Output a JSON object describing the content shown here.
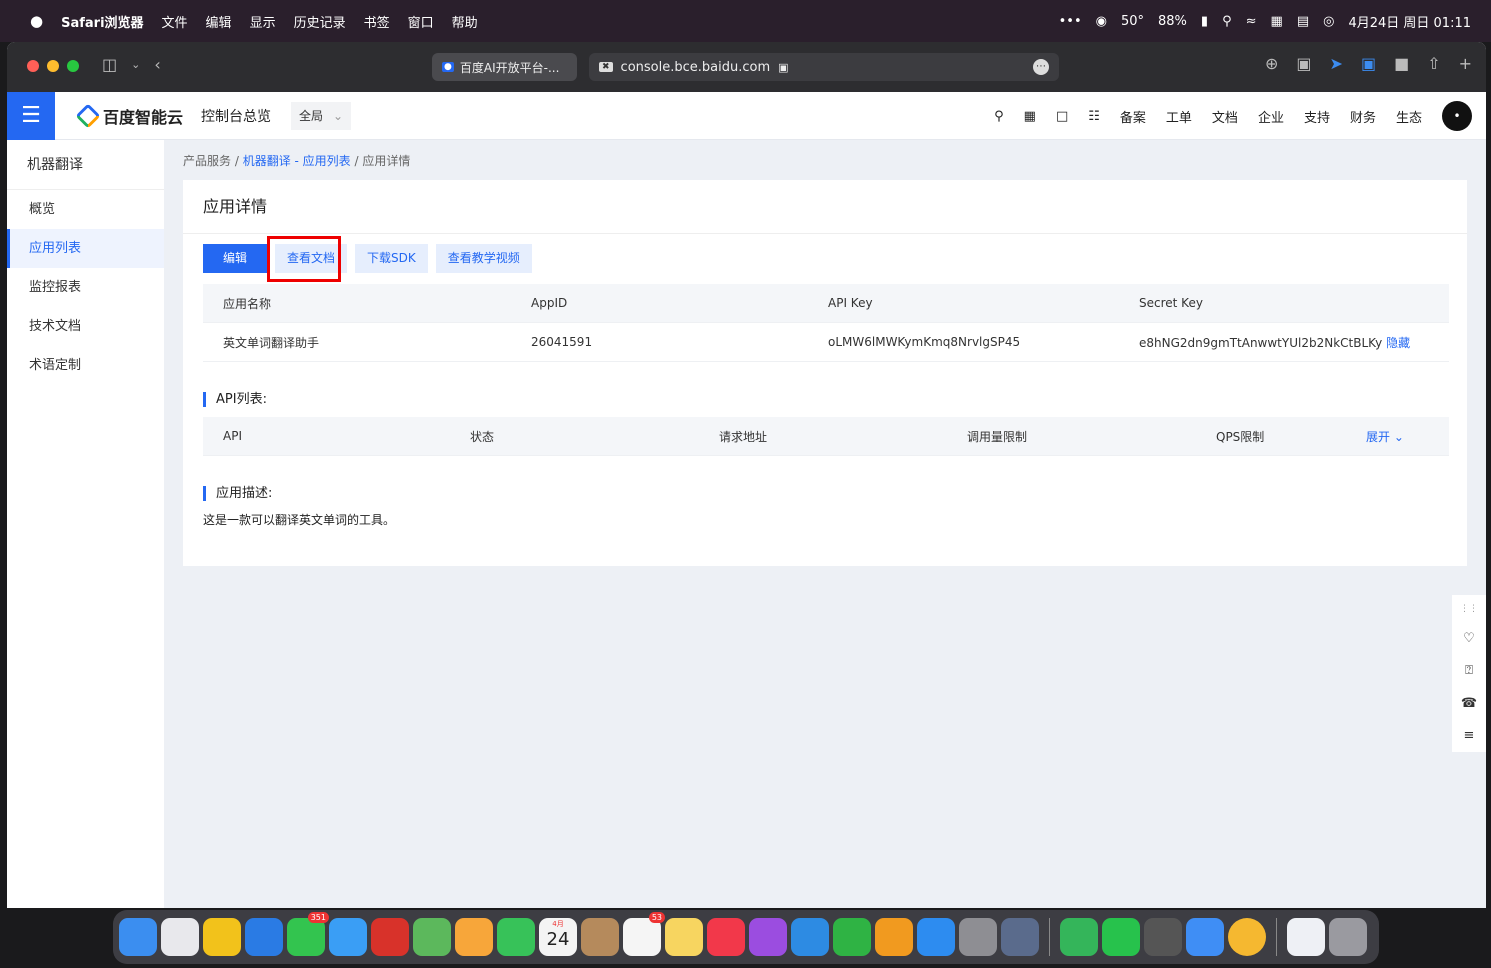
{
  "menubar": {
    "apple": "",
    "app": "Safari浏览器",
    "items": [
      "文件",
      "编辑",
      "显示",
      "历史记录",
      "书签",
      "窗口",
      "帮助"
    ],
    "status": {
      "dots": "•••",
      "temp": "50°",
      "battery": "88%",
      "datetime": "4月24日 周日 01:11"
    }
  },
  "browser": {
    "tab1_title": "百度AI开放平台-...",
    "url": "console.bce.baidu.com"
  },
  "topnav": {
    "logo": "百度智能云",
    "console": "控制台总览",
    "region": "全局",
    "links": [
      "备案",
      "工单",
      "文档",
      "企业",
      "支持",
      "财务",
      "生态"
    ]
  },
  "sidebar": {
    "title": "机器翻译",
    "items": [
      "概览",
      "应用列表",
      "监控报表",
      "技术文档",
      "术语定制"
    ]
  },
  "breadcrumb": {
    "root": "产品服务",
    "mid": "机器翻译 - 应用列表",
    "current": "应用详情",
    "sep": "/"
  },
  "card": {
    "title": "应用详情",
    "buttons": {
      "edit": "编辑",
      "docs": "查看文档",
      "sdk": "下载SDK",
      "video": "查看教学视频"
    },
    "table": {
      "headers": [
        "应用名称",
        "AppID",
        "API Key",
        "Secret Key"
      ],
      "row": {
        "name": "英文单词翻译助手",
        "appid": "26041591",
        "apikey": "oLMW6lMWKymKmq8NrvlgSP45",
        "secret": "e8hNG2dn9gmTtAnwwtYUl2b2NkCtBLKy",
        "hide": "隐藏"
      }
    },
    "api_section": "API列表:",
    "api_headers": [
      "API",
      "状态",
      "请求地址",
      "调用量限制",
      "QPS限制",
      "展开"
    ],
    "desc_section": "应用描述:",
    "desc": "这是一款可以翻译英文单词的工具。"
  },
  "dock": {
    "messages_badge": "351",
    "reminders_badge": "53",
    "calendar_month": "4月",
    "calendar_day": "24"
  }
}
